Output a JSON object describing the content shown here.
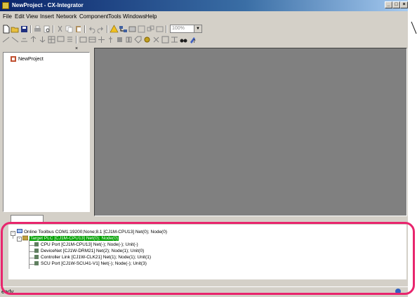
{
  "window": {
    "title": "NewProject - CX-Integrator"
  },
  "menu": [
    "File",
    "Edit",
    "View",
    "Insert",
    "Network",
    "Component",
    "Tools",
    "Windows",
    "Help"
  ],
  "toolbar": {
    "zoom_value": "100%"
  },
  "project": {
    "root_label": "NewProject"
  },
  "network_tree": {
    "root": "Online Toolbus COM1:19200;None;8.1 [CJ1M-CPU13] Net(0); Node(0)",
    "target": "Target PLC [CJ1M-CPU13] Net(0); Node(0)",
    "children": [
      "CPU Port [CJ1M-CPU13] Net(-); Node(-); Unit(-)",
      "DeviceNet [CJ1W-DRM21] Net(2); Node(1); Unit(0)",
      "Controller Link [CJ1W-CLK21] Net(1); Node(1); Unit(1)",
      "SCU Port [CJ1W-SCU41-V1] Net(-); Node(-); Unit(3)"
    ]
  },
  "status": {
    "left": "eady"
  },
  "colors": {
    "highlight_frame": "#e8256d",
    "title_bar": "#0a246a",
    "target_highlight": "#00a000"
  }
}
